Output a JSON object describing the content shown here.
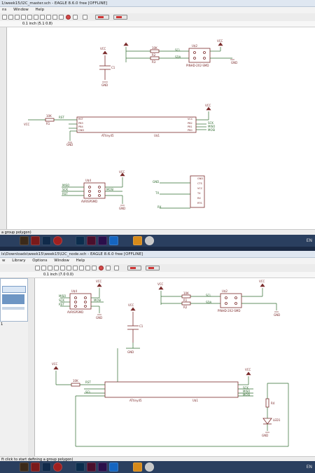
{
  "window1": {
    "title": "1/week15/I2C_master.sch - EAGLE 8.6.0 free [OFFLINE]",
    "menu": [
      "ns",
      "Window",
      "Help"
    ],
    "coord": "0.1 inch (5.1 0.8)",
    "status": "a group polygon)"
  },
  "window2": {
    "title": "ls\\Downloads\\week15\\week15\\I2C_node.sch - EAGLE 8.6.0 free [OFFLINE]",
    "menu": [
      "w",
      "Library",
      "Options",
      "Window",
      "Help"
    ],
    "coord": "0.1 inch (7.0 0.0)",
    "status": "ft click to start defining a group polygon)"
  },
  "taskbar": {
    "apps": [
      "AI",
      "PS",
      "ID",
      "PR",
      "VS",
      "E",
      "N"
    ],
    "tray": "EN"
  },
  "schematic1": {
    "vcc": "VCC",
    "gnd": "GND",
    "r1": "R1",
    "r1_val": "10K",
    "r2": "R2",
    "r2_val": "10K",
    "r3": "R3",
    "r3_val": "10K",
    "c1": "C1",
    "u1": "U$1",
    "u1_part": "ATtiny45",
    "u2": "U$2",
    "u2_part": "PINHD-2X2-SMD",
    "u4": "U$4",
    "u4_part": "AVRISPSMD",
    "rst": "RST",
    "pin_left": [
      "RST",
      "PB3",
      "PB4",
      "GND"
    ],
    "pin_right": [
      "VCC",
      "PB2",
      "PB1",
      "PB0"
    ],
    "sig_scl": "SCL",
    "sig_sda": "SDA",
    "sig_miso": "MISO",
    "sig_sck": "SCK",
    "sig_mosi": "MOSI",
    "sig_rst": "RST",
    "ftdi_pins": [
      "GND",
      "CTS",
      "VCC",
      "TX",
      "RX",
      "RTS"
    ],
    "ftdi_left": [
      "GND",
      "TX",
      "RX"
    ]
  },
  "schematic2": {
    "vcc": "VCC",
    "gnd": "GND",
    "r1": "R1",
    "r2": "R2",
    "r4": "R4",
    "res_val": "10K",
    "u1": "U$1",
    "u1_part": "ATtiny45",
    "u2": "U$2",
    "u2_part": "PINHD-2X2-SMD",
    "u4": "U$4",
    "u4_part": "AVRISPSMD",
    "c1": "C1",
    "led": "LED1",
    "sig_scl": "SCL",
    "sig_sda": "SDA",
    "sig_miso": "MISO",
    "sig_sck": "SCK",
    "sig_mosi": "MOSI",
    "sig_rst": "RST",
    "panel_row": "1"
  }
}
